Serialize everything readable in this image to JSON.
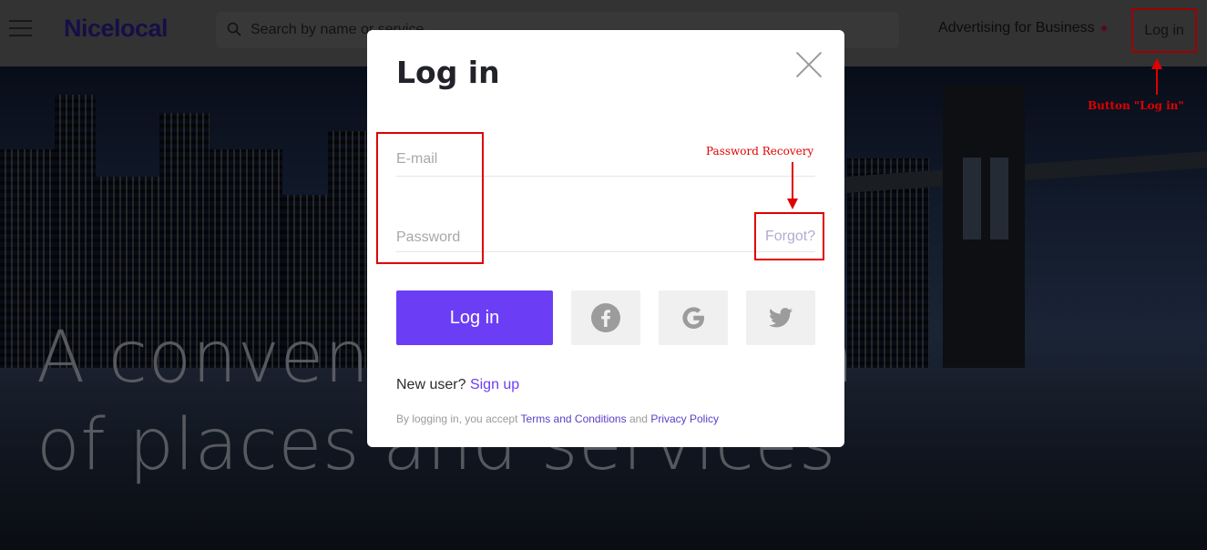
{
  "header": {
    "logo": "Nicelocal",
    "search_placeholder": "Search by name or service",
    "advertising_label": "Advertising for Business",
    "login_label": "Log in"
  },
  "hero": {
    "title_line1": "A convenient selection",
    "title_line2": "of places and services"
  },
  "modal": {
    "title": "Log in",
    "email_placeholder": "E-mail",
    "password_placeholder": "Password",
    "forgot_label": "Forgot?",
    "login_button": "Log in",
    "social": [
      "facebook-icon",
      "google-icon",
      "twitter-icon"
    ],
    "new_user_text": "New user?",
    "signup_label": "Sign up",
    "legal_prefix": "By logging in, you accept",
    "terms_label": "Terms and Conditions",
    "legal_and": "and",
    "privacy_label": "Privacy Policy"
  },
  "annotations": {
    "password_recovery": "Password Recovery",
    "login_button_note": "Button \"Log in\""
  },
  "colors": {
    "accent": "#6b3ef5",
    "annotation": "#e00000",
    "header_bg": "#474747"
  }
}
